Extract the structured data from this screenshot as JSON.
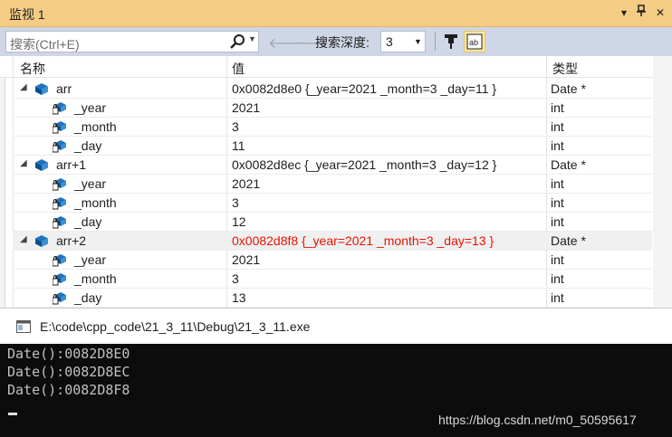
{
  "panel": {
    "title": "监视 1",
    "dropdown_icon": "chevron-down-icon",
    "pin_icon": "pin-icon",
    "close_icon": "close-icon",
    "accent_color": "#f5cc84"
  },
  "toolbar": {
    "search_placeholder": "搜索(Ctrl+E)",
    "depth_label": "搜索深度:",
    "depth_value": "3"
  },
  "columns": {
    "name": "名称",
    "value": "值",
    "type": "类型"
  },
  "rows": [
    {
      "name": "arr",
      "value": "0x0082d8e0 {_year=2021 _month=3 _day=11 }",
      "type": "Date *"
    },
    {
      "name": "_year",
      "value": "2021",
      "type": "int"
    },
    {
      "name": "_month",
      "value": "3",
      "type": "int"
    },
    {
      "name": "_day",
      "value": "11",
      "type": "int"
    },
    {
      "name": "arr+1",
      "value": "0x0082d8ec {_year=2021 _month=3 _day=12 }",
      "type": "Date *"
    },
    {
      "name": "_year",
      "value": "2021",
      "type": "int"
    },
    {
      "name": "_month",
      "value": "3",
      "type": "int"
    },
    {
      "name": "_day",
      "value": "12",
      "type": "int"
    },
    {
      "name": "arr+2",
      "value": "0x0082d8f8 {_year=2021 _month=3 _day=13 }",
      "type": "Date *"
    },
    {
      "name": "_year",
      "value": "2021",
      "type": "int"
    },
    {
      "name": "_month",
      "value": "3",
      "type": "int"
    },
    {
      "name": "_day",
      "value": "13",
      "type": "int"
    }
  ],
  "changed_value_color": "#e51400",
  "console": {
    "title": "E:\\code\\cpp_code\\21_3_11\\Debug\\21_3_11.exe",
    "lines": [
      "Date():0082D8E0",
      "Date():0082D8EC",
      "Date():0082D8F8"
    ],
    "watermark": "https://blog.csdn.net/m0_50595617"
  }
}
